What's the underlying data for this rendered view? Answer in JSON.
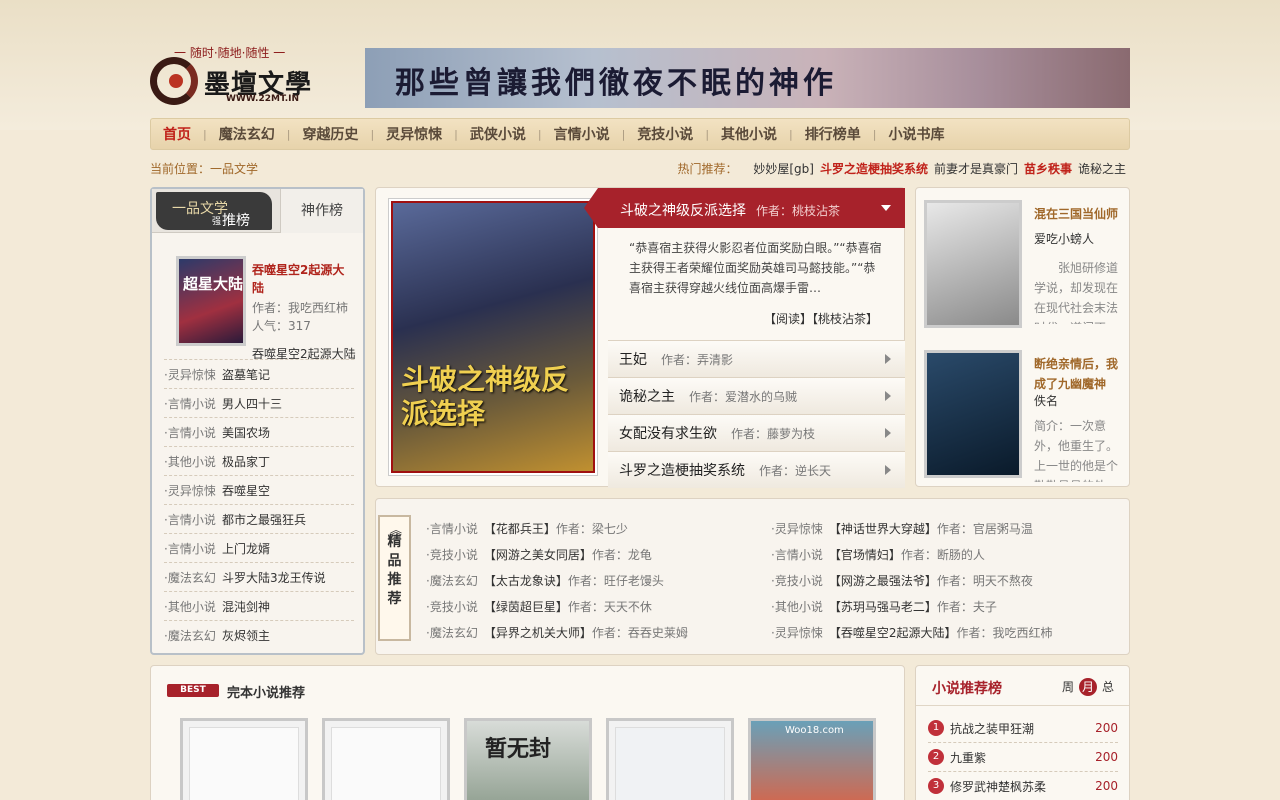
{
  "header": {
    "tagline": "一 随时·随地·随性 一",
    "site_name": "墨壇文學",
    "site_url": "WWW.22MT.IN",
    "banner_text": "那些曾讓我們徹夜不眠的神作"
  },
  "nav": {
    "items": [
      {
        "label": "首页",
        "active": true
      },
      {
        "label": "魔法玄幻"
      },
      {
        "label": "穿越历史"
      },
      {
        "label": "灵异惊悚"
      },
      {
        "label": "武侠小说"
      },
      {
        "label": "言情小说"
      },
      {
        "label": "竞技小说"
      },
      {
        "label": "其他小说"
      },
      {
        "label": "排行榜单"
      },
      {
        "label": "小说书库"
      }
    ]
  },
  "location": "当前位置：一品文学",
  "hot": {
    "label": "热门推荐：",
    "items": [
      {
        "text": "妙妙屋[gb]"
      },
      {
        "text": "斗罗之造梗抽奖系统",
        "red": true
      },
      {
        "text": "前妻才是真豪门"
      },
      {
        "text": "苗乡秩事",
        "red": true
      },
      {
        "text": "诡秘之主"
      }
    ]
  },
  "left_box": {
    "tab1_a": "一品文学",
    "tab1_b": "推榜",
    "tab1_c": "强",
    "tab2": "神作榜",
    "featured": {
      "cover_text": "超星大陆",
      "title": "吞噬星空2起源大陆",
      "author": "作者：我吃西红柿",
      "popularity": "人气：317",
      "desc": "吞噬星空2起源大陆"
    },
    "list": [
      {
        "cat": "·灵异惊悚",
        "name": "盗墓笔记"
      },
      {
        "cat": "·言情小说",
        "name": "男人四十三"
      },
      {
        "cat": "·言情小说",
        "name": "美国农场"
      },
      {
        "cat": "·其他小说",
        "name": "极品家丁"
      },
      {
        "cat": "·灵异惊悚",
        "name": "吞噬星空"
      },
      {
        "cat": "·言情小说",
        "name": "都市之最强狂兵"
      },
      {
        "cat": "·言情小说",
        "name": "上门龙婿"
      },
      {
        "cat": "·魔法玄幻",
        "name": "斗罗大陆3龙王传说"
      },
      {
        "cat": "·其他小说",
        "name": "混沌剑神"
      },
      {
        "cat": "·魔法玄幻",
        "name": "灰烬领主"
      }
    ]
  },
  "main_feature": {
    "cover_text": "斗破之神级反派选择",
    "title": "斗破之神级反派选择",
    "author": "作者：桃枝沾茶",
    "desc": "“恭喜宿主获得火影忍者位面奖励白眼。”“恭喜宿主获得王者荣耀位面奖励英雄司马懿技能。”“恭喜宿主获得穿越火线位面高爆手雷…",
    "links": "【阅读】【桃枝沾茶】",
    "list": [
      {
        "name": "王妃",
        "author": "作者：弄清影"
      },
      {
        "name": "诡秘之主",
        "author": "作者：爱潜水的乌贼"
      },
      {
        "name": "女配没有求生欲",
        "author": "作者：藤萝为枝"
      },
      {
        "name": "斗罗之造梗抽奖系统",
        "author": "作者：逆长天"
      }
    ]
  },
  "right_feature": [
    {
      "title": "混在三国当仙师",
      "author": "爱吃小螃人",
      "desc": "张旭研修道学说，却发现在在现代社会末法时代，道门不…",
      "color1": "#e8e8e8",
      "color2": "#8a8a8a"
    },
    {
      "title": "断绝亲情后，我成了九幽魔神",
      "author": "佚名",
      "desc": "简介：一次意外，他重生了。上一世的他是个勤勤恳恳的外…",
      "color1": "#2a4a6a",
      "color2": "#0a1a2a"
    }
  ],
  "jingpin": {
    "label": [
      "精",
      "品",
      "推",
      "荐"
    ],
    "left": [
      {
        "cat": "·言情小说",
        "book": "【花都兵王】",
        "author": "作者：梁七少"
      },
      {
        "cat": "·竞技小说",
        "book": "【网游之美女同居】",
        "author": "作者：龙龟"
      },
      {
        "cat": "·魔法玄幻",
        "book": "【太古龙象诀】",
        "author": "作者：旺仔老馒头"
      },
      {
        "cat": "·竞技小说",
        "book": "【绿茵超巨星】",
        "author": "作者：天天不休"
      },
      {
        "cat": "·魔法玄幻",
        "book": "【异界之机关大师】",
        "author": "作者：吞吞史莱姆"
      }
    ],
    "right": [
      {
        "cat": "·灵异惊悚",
        "book": "【神话世界大穿越】",
        "author": "作者：官居粥马温"
      },
      {
        "cat": "·言情小说",
        "book": "【官场情妇】",
        "author": "作者：断肠的人"
      },
      {
        "cat": "·竞技小说",
        "book": "【网游之最强法爷】",
        "author": "作者：明天不熬夜"
      },
      {
        "cat": "·其他小说",
        "book": "【苏玥马强马老二】",
        "author": "作者：夫子"
      },
      {
        "cat": "·灵异惊悚",
        "book": "【吞噬星空2起源大陆】",
        "author": "作者：我吃西红柿"
      }
    ]
  },
  "bottom": {
    "badge": "BEST",
    "title": "完本小说推荐",
    "cover3_text": "暂无封",
    "cover5_text": "Woo18.com"
  },
  "ranking": {
    "title": "小说推荐榜",
    "tabs": [
      {
        "label": "周"
      },
      {
        "label": "月",
        "on": true
      },
      {
        "label": "总"
      }
    ],
    "items": [
      {
        "n": "1",
        "name": "抗战之装甲狂潮",
        "v": "200"
      },
      {
        "n": "2",
        "name": "九重紫",
        "v": "200"
      },
      {
        "n": "3",
        "name": "修罗武神楚枫苏柔",
        "v": "200"
      }
    ]
  }
}
